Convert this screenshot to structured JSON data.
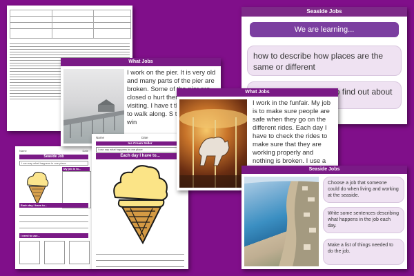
{
  "seaside_jobs_panel": {
    "title": "Seaside Jobs",
    "learning_header": "We are learning...",
    "objective_1": "how to describe how places are the same or different",
    "objective_2": "how to ask questions to find out about"
  },
  "what_jobs_pier": {
    "title": "What Jobs",
    "text": "I work on the pier. It is very old and many parts of the pier are broken. Some of the pier are closed o hurt themselves visiting. I have t the pier is fixed to walk along. S to clean the win"
  },
  "what_jobs_funfair": {
    "title": "What Jobs",
    "text": "I work in the funfair. My job is to make sure people are safe when they go on the different rides. Each day I have to check the rides to make sure that they are working properly and nothing is broken. I use a spanner and hammer to check all of the nuts and bolts on the different rides. I also"
  },
  "seaside_jobs_task": {
    "title": "Seaside Jobs",
    "task_1": "Choose a job that someone could do when living and working at the seaside.",
    "task_2": "Write some sentences describing what happens in the job each day.",
    "task_3": "Make a list of things needed to do the job."
  },
  "ice_cream_sheet": {
    "name_label": "Name",
    "date_label": "Date",
    "title": "Ice Cream Seller",
    "instruction": "I can say what happens in one place",
    "prompt": "Each day I have to..."
  },
  "small_sheet": {
    "name_label": "Name",
    "date_label": "Date",
    "title": "Seaside Job",
    "instruction": "I can say what happens in one place",
    "my_job_label": "My job is to...",
    "each_day_label": "Each day I have to...",
    "need_label": "I need to use..."
  },
  "colors": {
    "background": "#800f8a",
    "accent": "#7a1a86",
    "pill_fill": "#efe2f2"
  }
}
